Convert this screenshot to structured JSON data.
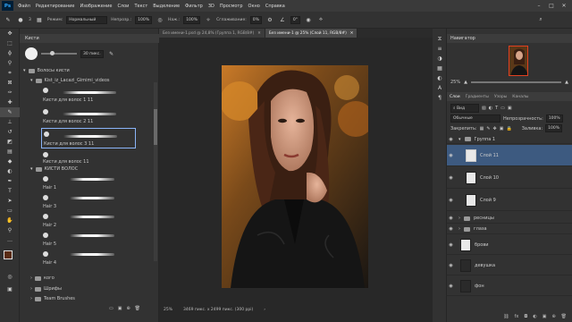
{
  "app": {
    "logo_text": "Ps",
    "menu": [
      "Файл",
      "Редактирование",
      "Изображение",
      "Слои",
      "Текст",
      "Выделение",
      "Фильтр",
      "3D",
      "Просмотр",
      "Окно",
      "Справка"
    ]
  },
  "options": {
    "brush_size": "3",
    "mode_label": "Режим:",
    "mode_value": "Нормальный",
    "opacity_label": "Непрозр.:",
    "opacity_value": "100%",
    "flow_label": "Наж.:",
    "flow_value": "100%",
    "smoothing_label": "Сглаживание:",
    "smoothing_value": "0%",
    "angle_value": "0°"
  },
  "brush_panel": {
    "tab_label": "Кисти",
    "size_value": "30 пикс.",
    "rows": [
      {
        "type": "folder",
        "label": "Волосы кисти"
      },
      {
        "type": "folder",
        "label": "Kist_iz_Lacazi_Gimimi_videos"
      },
      {
        "type": "brush",
        "label": "Кисти для волос 1 11"
      },
      {
        "type": "brush",
        "label": "Кисти для волос 2 11"
      },
      {
        "type": "brush",
        "label": "Кисти для волос 3 11"
      },
      {
        "type": "brush",
        "label": "Кисти для волос 11"
      },
      {
        "type": "folder",
        "label": "КИСТИ ВОЛОС"
      },
      {
        "type": "brush",
        "label": "Hair 1"
      },
      {
        "type": "brush",
        "label": "Hair 3"
      },
      {
        "type": "brush",
        "label": "Hair 2"
      },
      {
        "type": "brush",
        "label": "Hair 5"
      },
      {
        "type": "brush",
        "label": "Hair 4"
      },
      {
        "type": "folder",
        "label": "кого"
      },
      {
        "type": "folder",
        "label": "Шрифы"
      },
      {
        "type": "folder",
        "label": "Team Brushes"
      }
    ]
  },
  "document": {
    "tabs": [
      {
        "label": "Без имени-1.psd @ 24,8% (Группа 1, RGB/8#)"
      },
      {
        "label": "Без имени-1 @ 25% (Слой 11, RGB/8#)"
      }
    ],
    "zoom": "25%",
    "dimensions": "3469 пикс. x 2499 пикс. (300 ppi)"
  },
  "navigator": {
    "title": "Навигатор",
    "zoom": "25%"
  },
  "layers": {
    "tabs": [
      "Слои",
      "Градиенты",
      "Узоры",
      "Каналы"
    ],
    "kind_filter": "Вид",
    "blend_mode": "Обычные",
    "opacity_label": "Непрозрачность:",
    "opacity_value": "100%",
    "lock_label": "Закрепить:",
    "fill_label": "Заливка:",
    "fill_value": "100%",
    "items": [
      {
        "name": "Группа 1",
        "kind": "group"
      },
      {
        "name": "Слой 11",
        "kind": "layer",
        "selected": true
      },
      {
        "name": "Слой 10",
        "kind": "layer"
      },
      {
        "name": "Слой 9",
        "kind": "layer"
      },
      {
        "name": "ресницы",
        "kind": "group"
      },
      {
        "name": "глаза",
        "kind": "group"
      },
      {
        "name": "брови",
        "kind": "layer"
      },
      {
        "name": "девушка",
        "kind": "layer"
      },
      {
        "name": "фон",
        "kind": "layer"
      }
    ]
  },
  "colors": {
    "foreground": "#5a2c14",
    "background": "#1e1e1e",
    "selection": "#3d5a80"
  }
}
